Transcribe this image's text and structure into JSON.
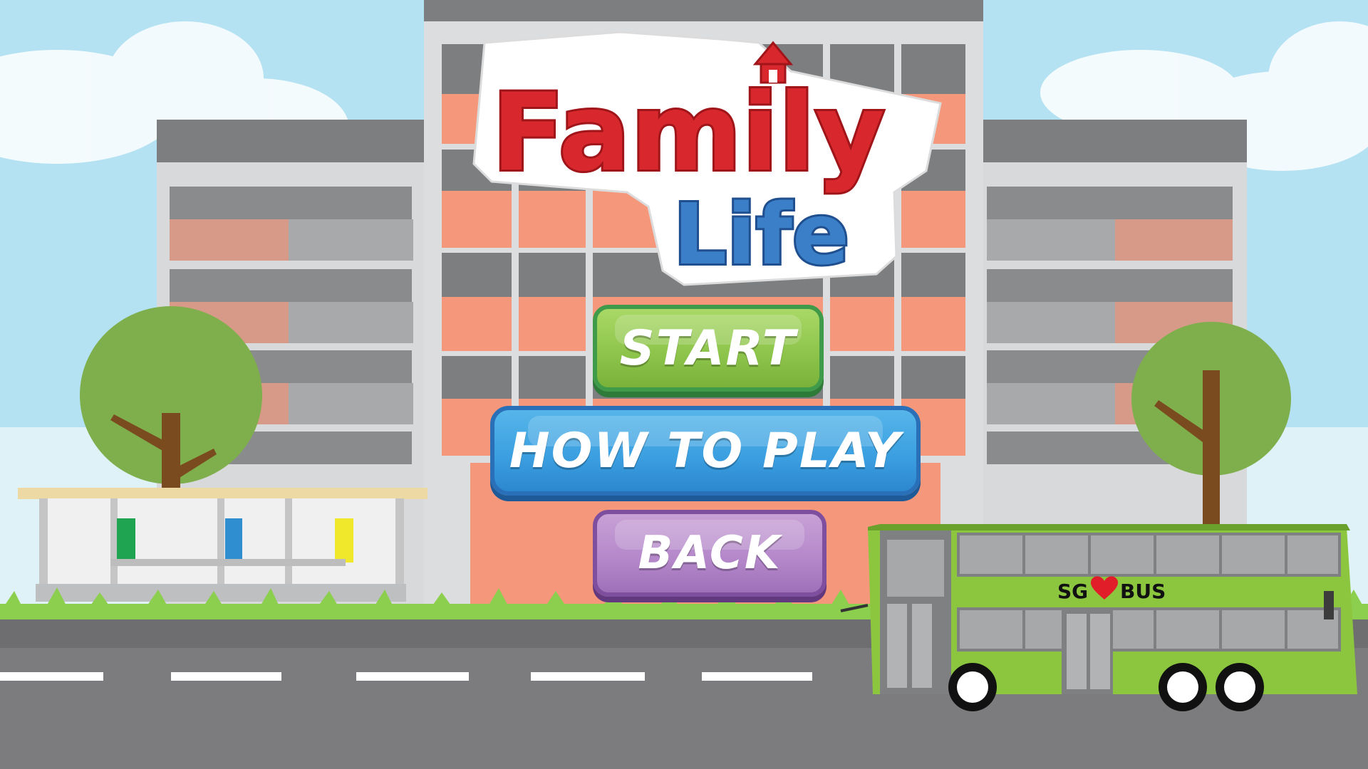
{
  "title": {
    "line1": "Family",
    "line2": "Life"
  },
  "menu": {
    "start_label": "START",
    "how_to_play_label": "HOW TO PLAY",
    "back_label": "BACK"
  },
  "bus": {
    "brand_left": "SG",
    "brand_right": "BUS",
    "brand_icon": "heart-icon"
  },
  "colors": {
    "sky": "#aee0f0",
    "building_orange": "#f5967a",
    "road": "#7a7a7c",
    "start_green": "#8cc34a",
    "how_blue": "#3a9ee0",
    "back_purple": "#b386c9",
    "bus_green": "#8cc63f",
    "title_red": "#d8282d",
    "title_blue": "#3a7fc8"
  }
}
